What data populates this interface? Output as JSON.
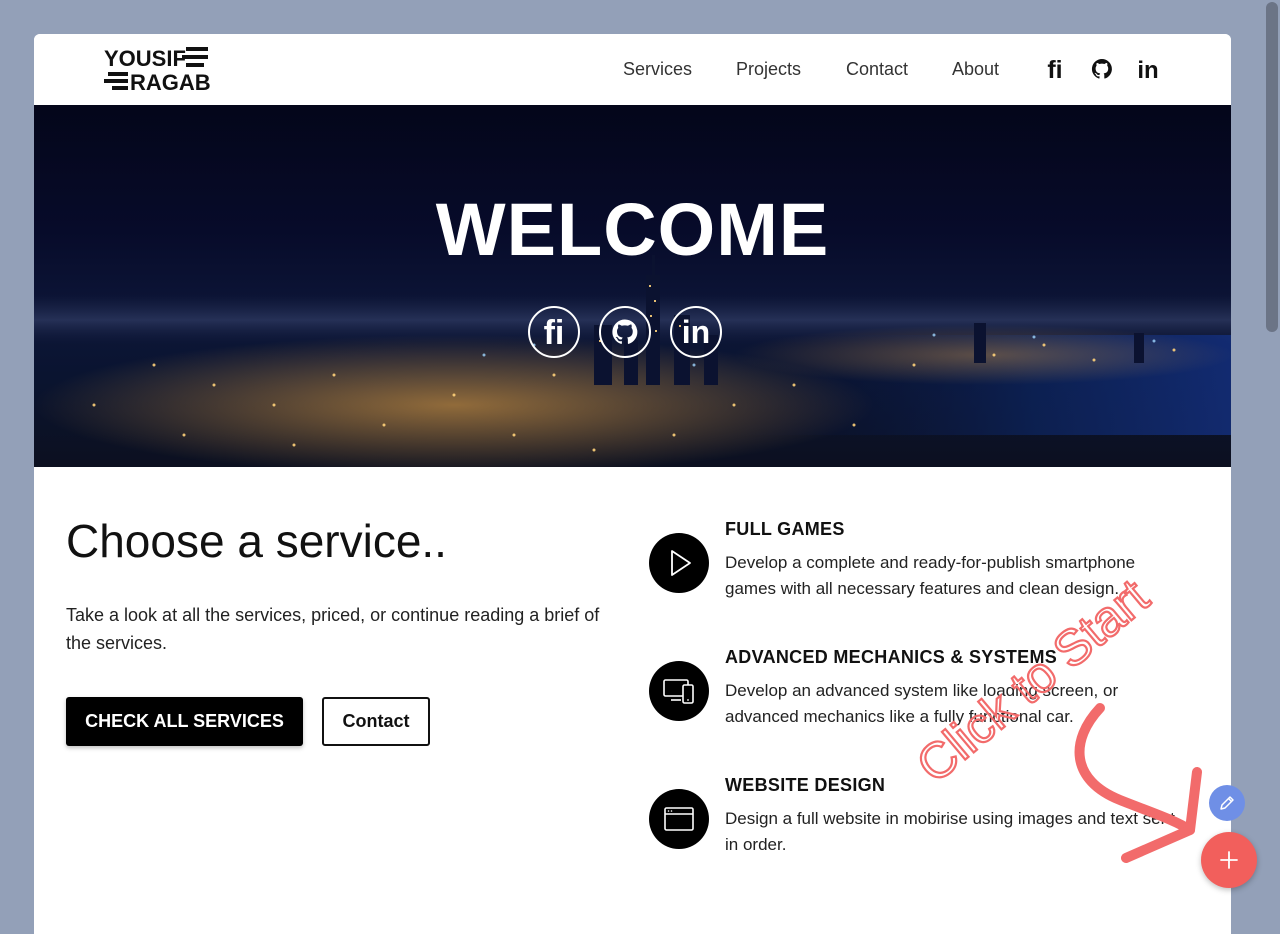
{
  "brand": {
    "line1": "YOUSIF",
    "line2": "RAGAB"
  },
  "nav": {
    "links": [
      "Services",
      "Projects",
      "Contact",
      "About"
    ],
    "social": [
      "fiverr-icon",
      "github-icon",
      "linkedin-icon"
    ]
  },
  "hero": {
    "title": "WELCOME",
    "social": [
      "fiverr-icon",
      "github-icon",
      "linkedin-icon"
    ]
  },
  "services": {
    "title": "Choose a service..",
    "description": "Take a look at all the services, priced, or continue reading a brief of the services.",
    "primary_button": "CHECK ALL SERVICES",
    "secondary_button": "Contact"
  },
  "features": [
    {
      "icon": "play-icon",
      "title": "FULL GAMES",
      "description": "Develop a complete and ready-for-publish smartphone games with all necessary features and clean design."
    },
    {
      "icon": "devices-icon",
      "title": "ADVANCED MECHANICS & SYSTEMS",
      "description": "Develop an advanced system like loading screen, or advanced mechanics like a fully functional car."
    },
    {
      "icon": "browser-window-icon",
      "title": "WEBSITE DESIGN",
      "description": "Design a full website in mobirise using images and text sent in order."
    }
  ],
  "overlay": {
    "hint": "Click to Start"
  },
  "colors": {
    "fab_add": "#f25f5c",
    "fab_edit": "#6f8fe6",
    "hint": "#f26b6b"
  }
}
